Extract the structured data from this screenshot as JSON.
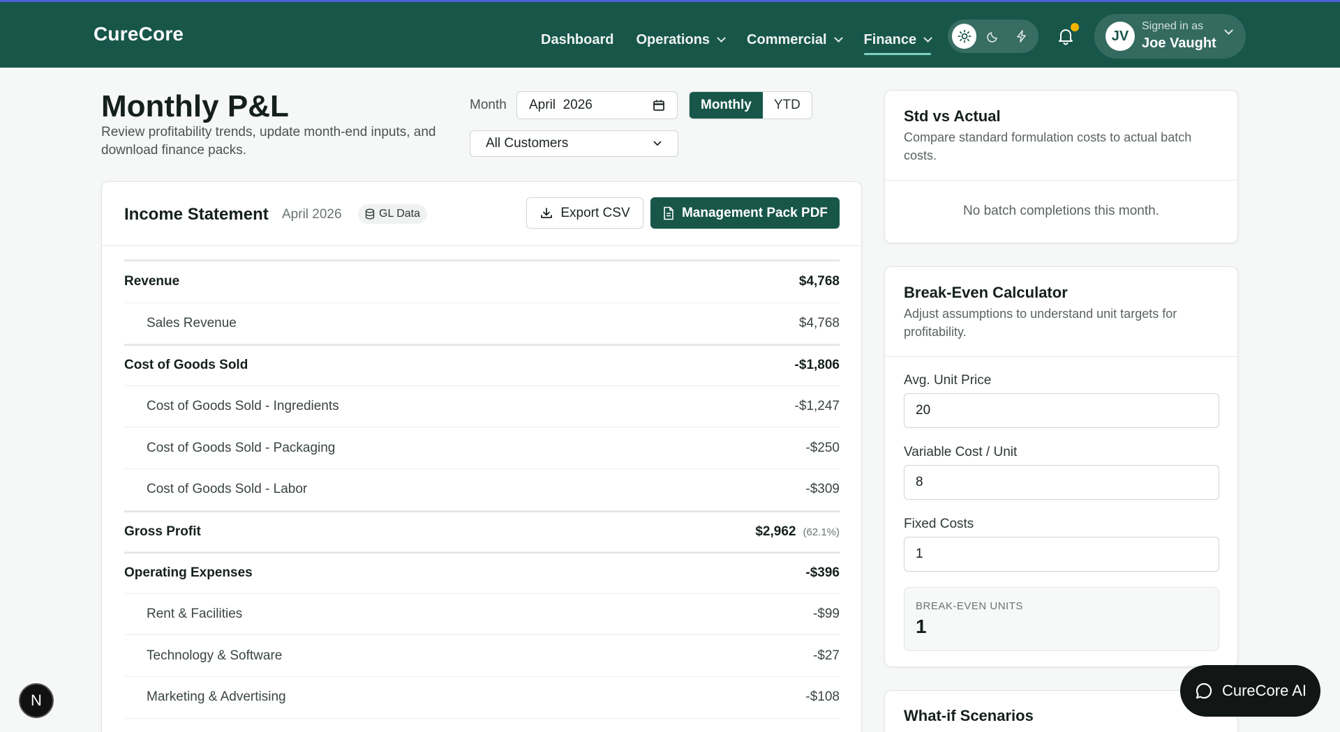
{
  "brand": "CureCore",
  "nav": [
    {
      "label": "Dashboard"
    },
    {
      "label": "Operations"
    },
    {
      "label": "Commercial"
    },
    {
      "label": "Finance"
    }
  ],
  "user": {
    "initials": "JV",
    "caption": "Signed in as",
    "name": "Joe Vaught"
  },
  "page": {
    "title": "Monthly P&L",
    "subtitle": "Review profitability trends, update month-end inputs, and download finance packs.",
    "month_label": "Month",
    "month_value": "April  2026",
    "view_options": [
      "Monthly",
      "YTD"
    ],
    "customer_select": "All Customers"
  },
  "income": {
    "title": "Income Statement",
    "month": "April 2026",
    "badge": "GL Data",
    "export_label": "Export CSV",
    "pdf_label": "Management Pack PDF",
    "rows": [
      {
        "label": "Revenue",
        "value": "$4,768"
      },
      {
        "label": "Sales Revenue",
        "value": "$4,768"
      },
      {
        "label": "Cost of Goods Sold",
        "value": "-$1,806"
      },
      {
        "label": "Cost of Goods Sold - Ingredients",
        "value": "-$1,247"
      },
      {
        "label": "Cost of Goods Sold - Packaging",
        "value": "-$250"
      },
      {
        "label": "Cost of Goods Sold - Labor",
        "value": "-$309"
      },
      {
        "label": "Gross Profit",
        "value": "$2,962",
        "pct": "(62.1%)"
      },
      {
        "label": "Operating Expenses",
        "value": "-$396"
      },
      {
        "label": "Rent & Facilities",
        "value": "-$99"
      },
      {
        "label": "Technology & Software",
        "value": "-$27"
      },
      {
        "label": "Marketing & Advertising",
        "value": "-$108"
      }
    ]
  },
  "std": {
    "title": "Std vs Actual",
    "desc": "Compare standard formulation costs to actual batch costs.",
    "empty": "No batch completions this month."
  },
  "breakeven": {
    "title": "Break-Even Calculator",
    "desc": "Adjust assumptions to understand unit targets for profitability.",
    "price_label": "Avg. Unit Price",
    "price_value": "20",
    "varcost_label": "Variable Cost / Unit",
    "varcost_value": "8",
    "fixed_label": "Fixed Costs",
    "fixed_value": "1",
    "result_caption": "BREAK-EVEN UNITS",
    "result_value": "1"
  },
  "whatif": {
    "title": "What-if Scenarios"
  },
  "ai_label": "CureCore AI",
  "n_badge": "N",
  "colors": {
    "brand": "#18564a",
    "accent_line": "#4e5fd1",
    "notify": "#f4b400"
  }
}
